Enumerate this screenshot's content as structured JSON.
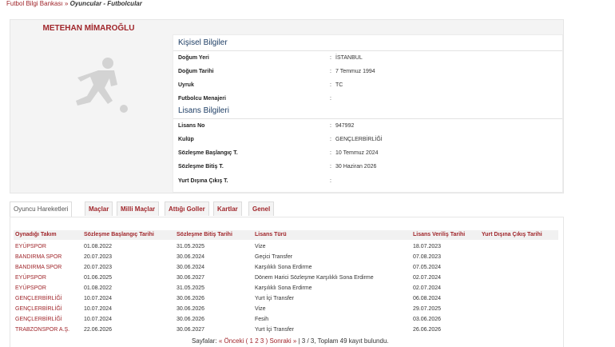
{
  "breadcrumb": {
    "root": "Futbol Bilgi Bankası",
    "separator": "»",
    "current": "Oyuncular - Futbolcular"
  },
  "player": {
    "name": "METEHAN MİMAROĞLU"
  },
  "personal": {
    "title": "Kişisel Bilgiler",
    "rows": [
      {
        "label": "Doğum Yeri",
        "value": "İSTANBUL"
      },
      {
        "label": "Doğum Tarihi",
        "value": "7 Temmuz 1994"
      },
      {
        "label": "Uyruk",
        "value": "TC"
      },
      {
        "label": "Futbolcu Menajeri",
        "value": ""
      }
    ]
  },
  "license": {
    "title": "Lisans Bilgileri",
    "rows": [
      {
        "label": "Lisans No",
        "value": "947992"
      },
      {
        "label": "Kulüp",
        "value": "GENÇLERBİRLİĞİ"
      },
      {
        "label": "Sözleşme Başlangıç T.",
        "value": "10 Temmuz 2024"
      },
      {
        "label": "Sözleşme Bitiş T.",
        "value": "30 Haziran 2026"
      },
      {
        "label": "Yurt Dışına Çıkış T.",
        "value": ""
      }
    ]
  },
  "tabs": [
    {
      "label": "Oyuncu Hareketleri",
      "active": true
    },
    {
      "label": "Maçlar",
      "active": false
    },
    {
      "label": "Milli Maçlar",
      "active": false
    },
    {
      "label": "Attığı Goller",
      "active": false
    },
    {
      "label": "Kartlar",
      "active": false
    },
    {
      "label": "Genel",
      "active": false
    }
  ],
  "movements": {
    "columns": [
      "Oynadığı Takım",
      "Sözleşme Başlangıç Tarihi",
      "Sözleşme Bitiş Tarihi",
      "Lisans Türü",
      "Lisans Veriliş Tarihi",
      "Yurt Dışına Çıkış Tarihi"
    ],
    "rows": [
      [
        "EYÜPSPOR",
        "01.08.2022",
        "31.05.2025",
        "Vize",
        "18.07.2023",
        ""
      ],
      [
        "BANDIRMA SPOR",
        "20.07.2023",
        "30.06.2024",
        "Geçici Transfer",
        "07.08.2023",
        ""
      ],
      [
        "BANDIRMA SPOR",
        "20.07.2023",
        "30.06.2024",
        "Karşılıklı Sona Erdirme",
        "07.05.2024",
        ""
      ],
      [
        "EYÜPSPOR",
        "01.06.2025",
        "30.06.2027",
        "Dönem Harici Sözleşme Karşılıklı Sona Erdirme",
        "02.07.2024",
        ""
      ],
      [
        "EYÜPSPOR",
        "01.08.2022",
        "31.05.2025",
        "Karşılıklı Sona Erdirme",
        "02.07.2024",
        ""
      ],
      [
        "GENÇLERBİRLİĞİ",
        "10.07.2024",
        "30.06.2026",
        "Yurt İçi Transfer",
        "06.08.2024",
        ""
      ],
      [
        "GENÇLERBİRLİĞİ",
        "10.07.2024",
        "30.06.2026",
        "Vize",
        "29.07.2025",
        ""
      ],
      [
        "GENÇLERBİRLİĞİ",
        "10.07.2024",
        "30.06.2026",
        "Fesih",
        "03.06.2026",
        ""
      ],
      [
        "TRABZONSPOR A.Ş.",
        "22.06.2026",
        "30.06.2027",
        "Yurt İçi Transfer",
        "26.06.2026",
        ""
      ]
    ]
  },
  "pager": {
    "prefix": "Sayfalar:",
    "prev": "« Önceki (",
    "pages": [
      "1",
      "2",
      "3"
    ],
    "next": ") Sonraki »",
    "summary": "| 3 / 3, Toplam 49 kayıt bulundu."
  }
}
